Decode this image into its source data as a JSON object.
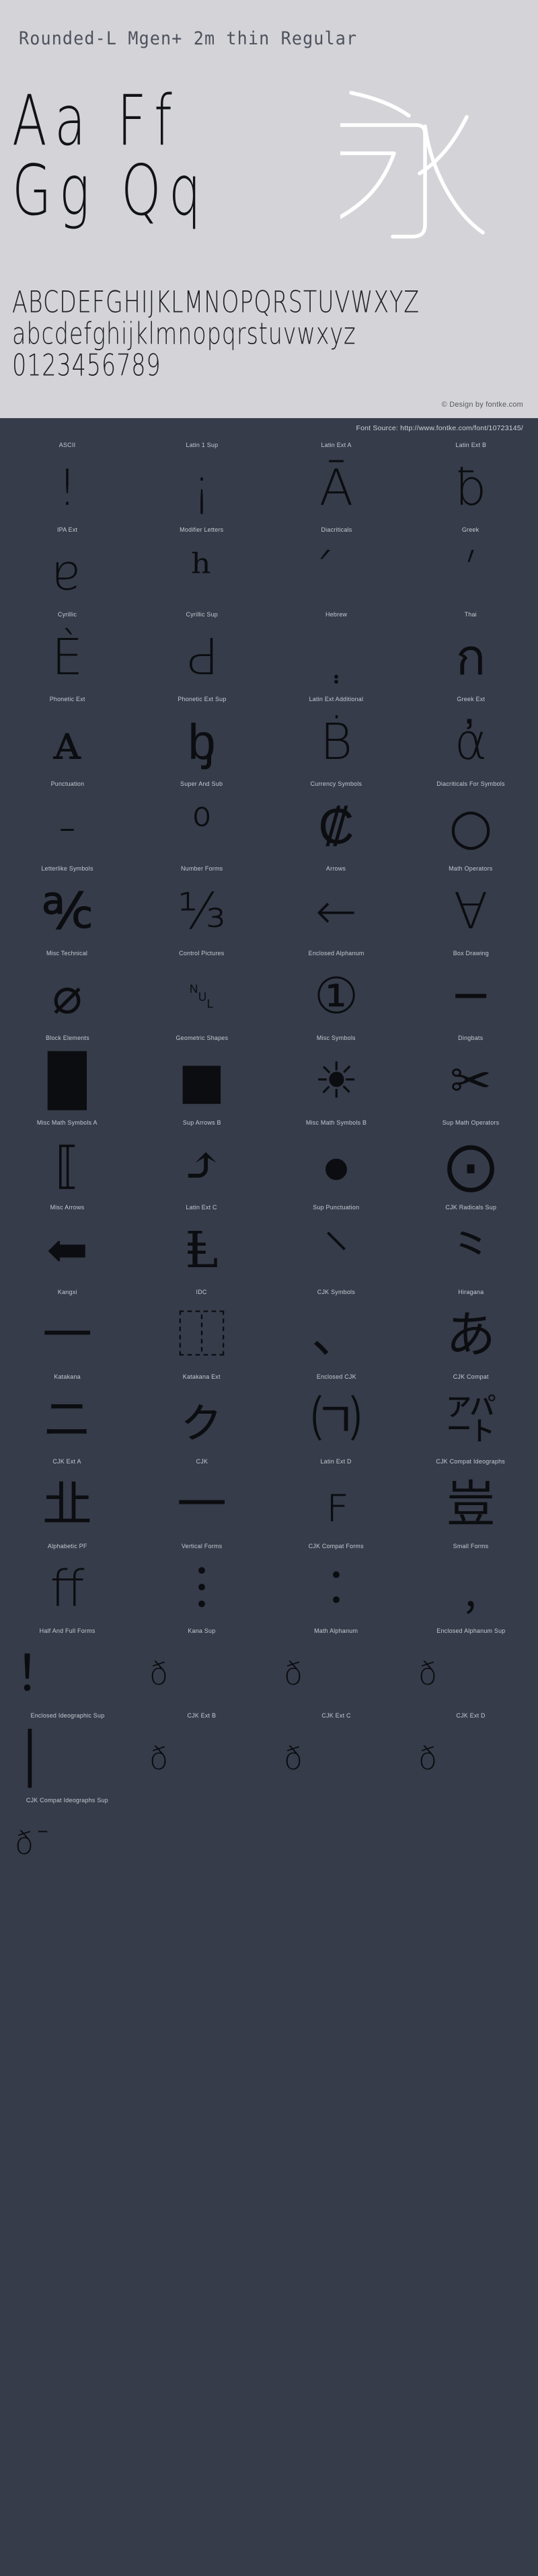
{
  "specimen": {
    "title": "Rounded-L Mgen+ 2m thin Regular",
    "big_rows": [
      "Aa  Ff",
      "Gg  Qq"
    ],
    "kanji_sample": "永",
    "alphabet_uppercase": "ABCDEFGHIJKLMNOPQRSTUVWXYZ",
    "alphabet_lowercase": "abcdefghijklmnopqrstuvwxyz",
    "digits": "0123456789",
    "copyright": "© Design by fontke.com",
    "font_source": "Font Source: http://www.fontke.com/font/10723145/",
    "bg_color": "#d4d4d8",
    "text_color": "#111318",
    "kanji_color": "#ffffff"
  },
  "grid": {
    "bg_color": "#363c4a",
    "label_color": "#c7cad2",
    "glyph_color": "#0c0d10",
    "rows": [
      [
        {
          "label": "ASCII",
          "glyph": "!",
          "size": "normal"
        },
        {
          "label": "Latin 1 Sup",
          "glyph": "¡",
          "size": "normal"
        },
        {
          "label": "Latin Ext A",
          "glyph": "Ā",
          "size": "normal"
        },
        {
          "label": "Latin Ext B",
          "glyph": "ƀ",
          "size": "normal"
        }
      ],
      [
        {
          "label": "IPA Ext",
          "glyph": "ɐ",
          "size": "normal"
        },
        {
          "label": "Modifier Letters",
          "glyph": "ʰ",
          "size": "normal"
        },
        {
          "label": "Diacriticals",
          "glyph": "́",
          "size": "normal"
        },
        {
          "label": "Greek",
          "glyph": "ʹ",
          "size": "normal"
        }
      ],
      [
        {
          "label": "Cyrillic",
          "glyph": "Ѐ",
          "size": "normal"
        },
        {
          "label": "Cyrillic Sup",
          "glyph": "Ԁ",
          "size": "normal"
        },
        {
          "label": "Hebrew",
          "glyph": "ְ",
          "size": "normal"
        },
        {
          "label": "Thai",
          "glyph": "ก",
          "size": "normal"
        }
      ],
      [
        {
          "label": "Phonetic Ext",
          "glyph": "ᴀ",
          "size": "normal"
        },
        {
          "label": "Phonetic Ext Sup",
          "glyph": "ᶀ",
          "size": "normal"
        },
        {
          "label": "Latin Ext Additional",
          "glyph": "Ḃ",
          "size": "normal"
        },
        {
          "label": "Greek Ext",
          "glyph": "ἀ",
          "size": "normal"
        }
      ],
      [
        {
          "label": "Punctuation",
          "glyph": "‐",
          "size": "normal"
        },
        {
          "label": "Super And Sub",
          "glyph": "⁰",
          "size": "normal"
        },
        {
          "label": "Currency Symbols",
          "glyph": "₡",
          "size": "normal"
        },
        {
          "label": "Diacriticals For Symbols",
          "glyph": "○",
          "size": "normal"
        }
      ],
      [
        {
          "label": "Letterlike Symbols",
          "glyph": "℀",
          "size": "normal"
        },
        {
          "label": "Number Forms",
          "glyph": "⅓",
          "size": "normal"
        },
        {
          "label": "Arrows",
          "glyph": "←",
          "size": "normal"
        },
        {
          "label": "Math Operators",
          "glyph": "∀",
          "size": "normal"
        }
      ],
      [
        {
          "label": "Misc Technical",
          "glyph": "⌀",
          "size": "normal"
        },
        {
          "label": "Control Pictures",
          "glyph": "␀",
          "size": "small"
        },
        {
          "label": "Enclosed Alphanum",
          "glyph": "①",
          "size": "normal"
        },
        {
          "label": "Box Drawing",
          "glyph": "─",
          "size": "normal"
        }
      ],
      [
        {
          "label": "Block Elements",
          "glyph": "█",
          "size": "normal"
        },
        {
          "label": "Geometric Shapes",
          "glyph": "■",
          "size": "normal"
        },
        {
          "label": "Misc Symbols",
          "glyph": "☀",
          "size": "normal"
        },
        {
          "label": "Dingbats",
          "glyph": "✂",
          "size": "normal"
        }
      ],
      [
        {
          "label": "Misc Math Symbols A",
          "glyph": "⟦",
          "size": "normal"
        },
        {
          "label": "Sup Arrows B",
          "glyph": "⤴",
          "size": "normal"
        },
        {
          "label": "Misc Math Symbols B",
          "glyph": "⦁",
          "size": "normal"
        },
        {
          "label": "Sup Math Operators",
          "glyph": "⨀",
          "size": "normal"
        }
      ],
      [
        {
          "label": "Misc Arrows",
          "glyph": "⬅",
          "size": "normal"
        },
        {
          "label": "Latin Ext C",
          "glyph": "Ⱡ",
          "size": "normal"
        },
        {
          "label": "Sup Punctuation",
          "glyph": "⸌",
          "size": "normal"
        },
        {
          "label": "CJK Radicals Sup",
          "glyph": "⺀",
          "size": "normal"
        }
      ],
      [
        {
          "label": "Kangxi",
          "glyph": "⼀",
          "size": "normal"
        },
        {
          "label": "IDC",
          "glyph": "⿰",
          "size": "normal"
        },
        {
          "label": "CJK Symbols",
          "glyph": "、",
          "size": "normal"
        },
        {
          "label": "Hiragana",
          "glyph": "あ",
          "size": "normal"
        }
      ],
      [
        {
          "label": "Katakana",
          "glyph": "ニ",
          "size": "normal"
        },
        {
          "label": "Katakana Ext",
          "glyph": "ㇰ",
          "size": "normal"
        },
        {
          "label": "Enclosed CJK",
          "glyph": "㈀",
          "size": "normal"
        },
        {
          "label": "CJK Compat",
          "glyph": "㌀",
          "size": "normal"
        }
      ],
      [
        {
          "label": "CJK Ext A",
          "glyph": "㐀",
          "size": "normal"
        },
        {
          "label": "CJK",
          "glyph": "一",
          "size": "normal"
        },
        {
          "label": "Latin Ext D",
          "glyph": "ꜰ",
          "size": "normal"
        },
        {
          "label": "CJK Compat Ideographs",
          "glyph": "豈",
          "size": "normal"
        }
      ],
      [
        {
          "label": "Alphabetic PF",
          "glyph": "ﬀ",
          "size": "normal"
        },
        {
          "label": "Vertical Forms",
          "glyph": "︙",
          "size": "normal"
        },
        {
          "label": "CJK Compat Forms",
          "glyph": "︰",
          "size": "normal"
        },
        {
          "label": "Small Forms",
          "glyph": "﹐",
          "size": "normal"
        }
      ],
      [
        {
          "label": "Half And Full Forms",
          "glyph": "！",
          "size": "normal"
        },
        {
          "label": "Kana Sup",
          "glyph": "ð",
          "size": "tofu"
        },
        {
          "label": "Math Alphanum",
          "glyph": "ð",
          "size": "tofu"
        },
        {
          "label": "Enclosed Alphanum Sup",
          "glyph": "ð",
          "size": "tofu"
        }
      ],
      [
        {
          "label": "Enclosed Ideographic Sup",
          "glyph": "│",
          "size": "normal"
        },
        {
          "label": "CJK Ext B",
          "glyph": "ð",
          "size": "tofu"
        },
        {
          "label": "CJK Ext C",
          "glyph": "ð",
          "size": "tofu"
        },
        {
          "label": "CJK Ext D",
          "glyph": "ð",
          "size": "tofu"
        }
      ],
      [
        {
          "label": "CJK Compat Ideographs Sup",
          "glyph": "ð¯",
          "size": "tofu"
        },
        {
          "label": "",
          "glyph": "",
          "size": "normal"
        },
        {
          "label": "",
          "glyph": "",
          "size": "normal"
        },
        {
          "label": "",
          "glyph": "",
          "size": "normal"
        }
      ]
    ]
  }
}
